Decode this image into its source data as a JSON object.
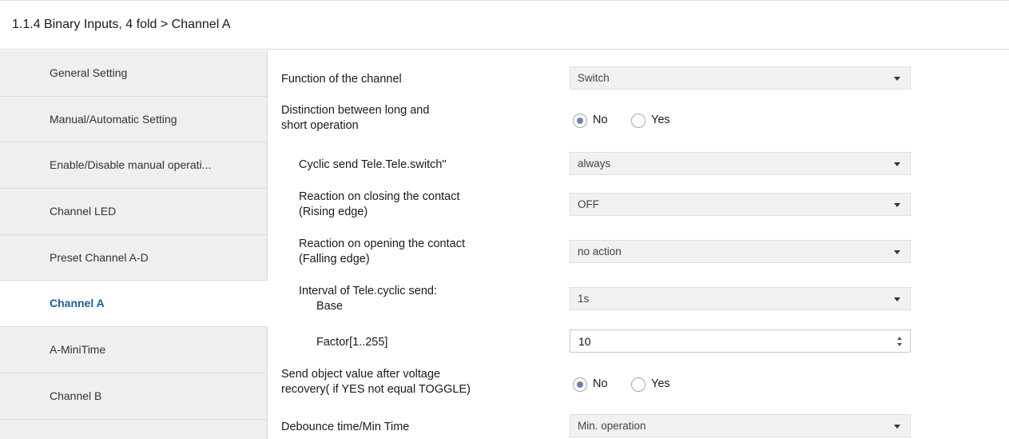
{
  "header": {
    "title": "1.1.4 Binary Inputs, 4 fold > Channel A"
  },
  "sidebar": {
    "items": [
      {
        "label": "General Setting",
        "active": false
      },
      {
        "label": "Manual/Automatic Setting",
        "active": false
      },
      {
        "label": "Enable/Disable manual operati...",
        "active": false
      },
      {
        "label": "Channel LED",
        "active": false
      },
      {
        "label": "Preset Channel A-D",
        "active": false
      },
      {
        "label": "Channel A",
        "active": true
      },
      {
        "label": "A-MiniTime",
        "active": false
      },
      {
        "label": "Channel B",
        "active": false
      }
    ]
  },
  "params": {
    "function": {
      "label": "Function of the channel",
      "value": "Switch"
    },
    "distinction": {
      "label_line1": "Distinction between long and",
      "label_line2": "short operation",
      "option_no": "No",
      "option_yes": "Yes",
      "selected": "No"
    },
    "cyclic_send": {
      "label": "Cyclic send Tele.Tele.switch\"",
      "value": "always"
    },
    "reaction_closing": {
      "label_line1": "Reaction on closing the contact",
      "label_line2": "(Rising edge)",
      "value": "OFF"
    },
    "reaction_opening": {
      "label_line1": "Reaction on opening the contact",
      "label_line2": "(Falling edge)",
      "value": "no action"
    },
    "interval": {
      "label_line1": "Interval of Tele.cyclic send:",
      "label_line2": "Base",
      "value": "1s"
    },
    "factor": {
      "label": "Factor[1..255]",
      "value": "10"
    },
    "send_object": {
      "label_line1": "Send object value after voltage",
      "label_line2": "recovery( if YES not equal TOGGLE)",
      "option_no": "No",
      "option_yes": "Yes",
      "selected": "No"
    },
    "debounce": {
      "label": "Debounce time/Min Time",
      "value": "Min. operation"
    }
  }
}
